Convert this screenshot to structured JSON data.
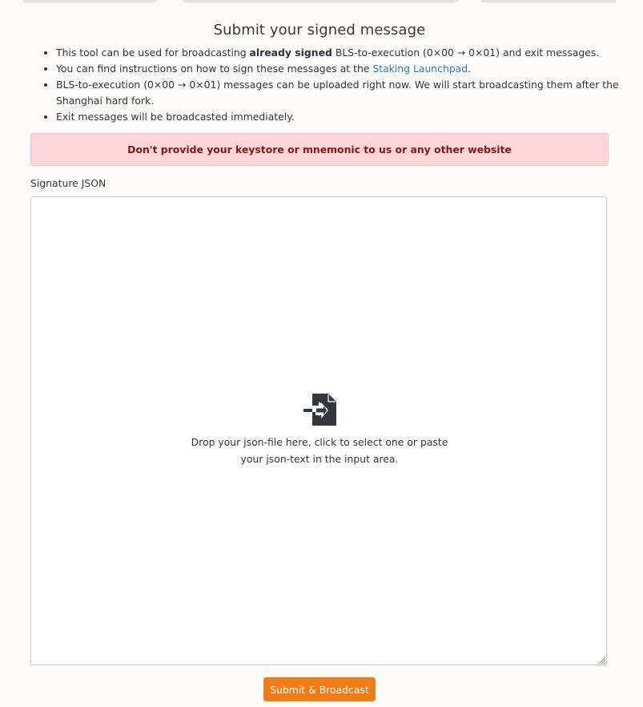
{
  "header": {
    "title": "Submit your signed message"
  },
  "info": {
    "item1_prefix": "This tool can be used for broadcasting ",
    "item1_bold": "already signed",
    "item1_suffix": " BLS-to-execution (0×00 → 0×01) and exit messages.",
    "item2_prefix": "You can find instructions on how to sign these messages at the ",
    "item2_link": "Staking Launchpad",
    "item2_suffix": ".",
    "item3": "BLS-to-execution (0×00 → 0×01) messages can be uploaded right now. We will start broadcasting them after the Shanghai hard fork.",
    "item4": "Exit messages will be broadcasted immediately."
  },
  "alert": {
    "text": "Don't provide your keystore or mnemonic to us or any other website"
  },
  "form": {
    "label": "Signature JSON",
    "drop_line1": "Drop your json-file here, click to select one or paste",
    "drop_line2": "your json-text in the input area.",
    "icon": "file-import-icon"
  },
  "actions": {
    "submit_label": "Submit & Broadcast"
  },
  "colors": {
    "accent": "#f07b17",
    "alert_bg": "#fed6d8",
    "alert_text": "#7a1a20",
    "link": "#2c7bc0"
  }
}
